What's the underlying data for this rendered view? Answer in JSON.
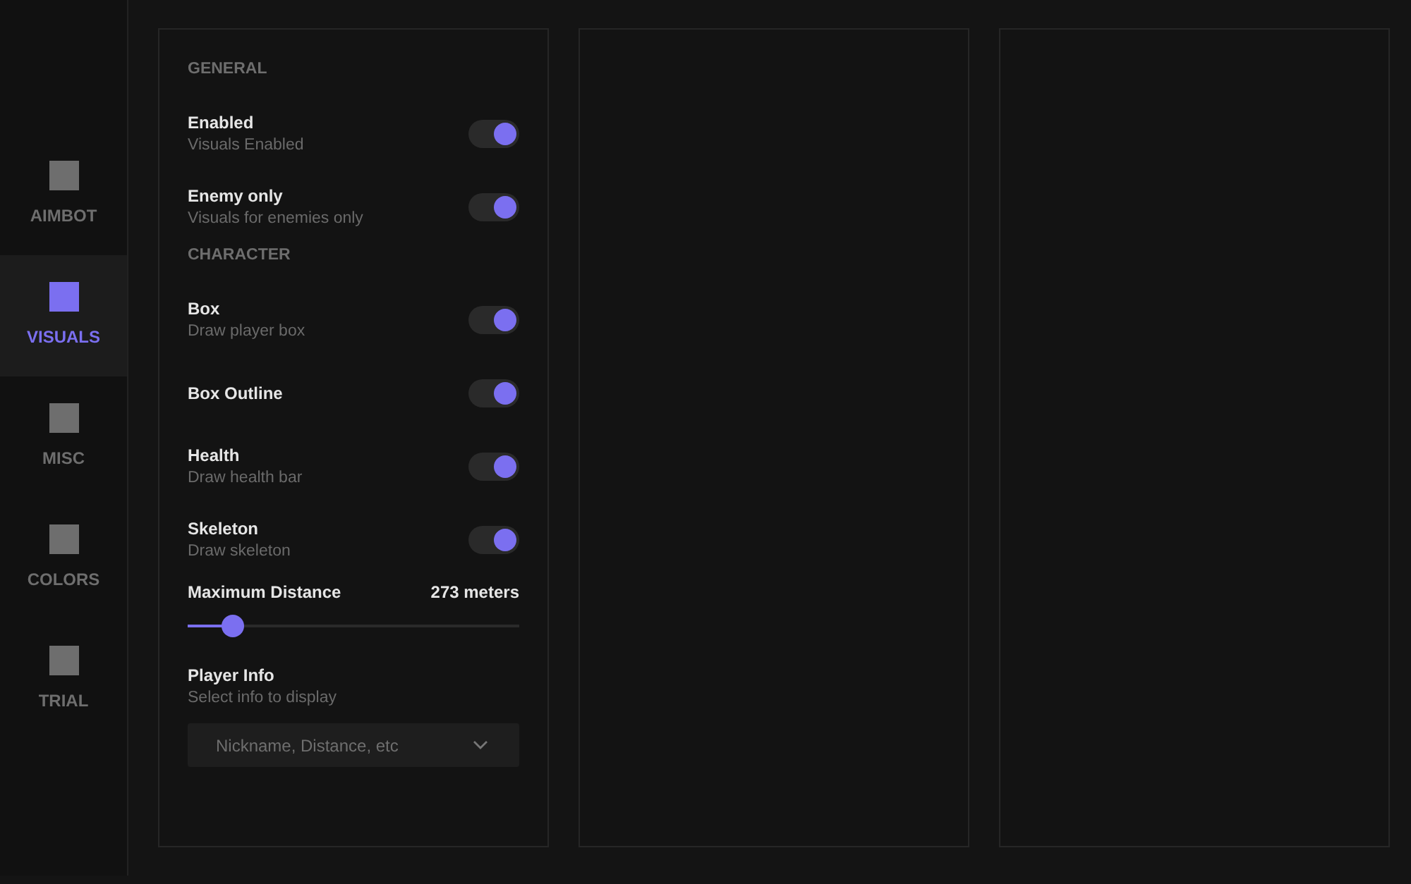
{
  "sidebar": {
    "items": [
      {
        "label": "AIMBOT",
        "selected": false
      },
      {
        "label": "VISUALS",
        "selected": true
      },
      {
        "label": "MISC",
        "selected": false
      },
      {
        "label": "COLORS",
        "selected": false
      },
      {
        "label": "TRIAL",
        "selected": false
      }
    ]
  },
  "panel": {
    "items": [
      {
        "kind": "section",
        "label": "GENERAL"
      },
      {
        "kind": "toggle",
        "label": "Enabled",
        "description": "Visuals Enabled",
        "on": true
      },
      {
        "kind": "toggle",
        "label": "Enemy only",
        "description": "Visuals for enemies only",
        "on": true
      },
      {
        "kind": "section",
        "label": "CHARACTER"
      },
      {
        "kind": "toggle",
        "label": "Box",
        "description": "Draw player box",
        "on": true
      },
      {
        "kind": "toggle",
        "label": "Box Outline",
        "on": true
      },
      {
        "kind": "toggle",
        "label": "Health",
        "description": "Draw health bar",
        "on": true
      },
      {
        "kind": "toggle",
        "label": "Skeleton",
        "description": "Draw skeleton",
        "on": true
      },
      {
        "kind": "slider",
        "label": "Maximum Distance",
        "reading": "273 meters",
        "level": 0.136
      },
      {
        "kind": "select",
        "label": "Player Info",
        "description": "Select info to display",
        "placeholder": "Nickname, Distance, etc"
      }
    ]
  }
}
